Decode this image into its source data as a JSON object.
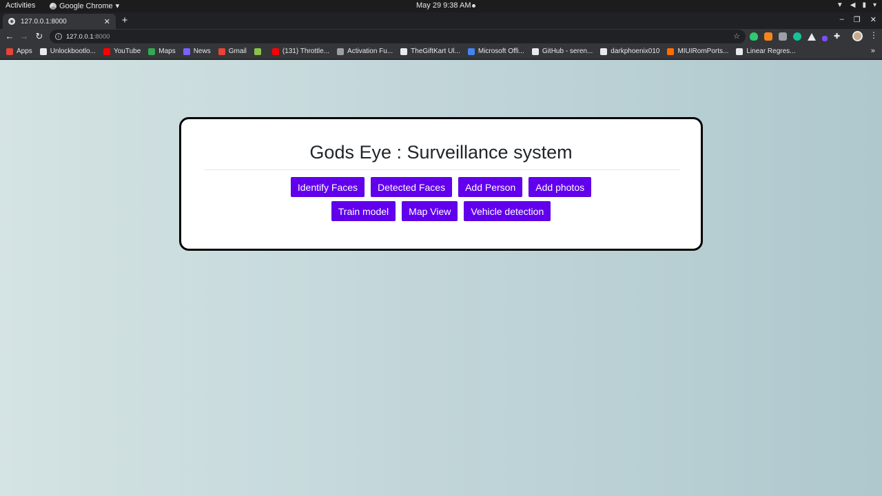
{
  "os": {
    "activities": "Activities",
    "app_name": "Google Chrome",
    "clock": "May 29   9:38 AM"
  },
  "browser": {
    "tab_title": "127.0.0.1:8000",
    "url_host": "127.0.0.1",
    "url_port": ":8000",
    "bookmarks": [
      {
        "label": "Apps",
        "icon_color": "#ea4335"
      },
      {
        "label": "Unlockbootlo...",
        "icon_color": "#e8eaed"
      },
      {
        "label": "YouTube",
        "icon_color": "#ff0000"
      },
      {
        "label": "Maps",
        "icon_color": "#34a853"
      },
      {
        "label": "News",
        "icon_color": "#7b61ff"
      },
      {
        "label": "Gmail",
        "icon_color": "#ea4335"
      },
      {
        "label": "",
        "icon_color": "#8bc34a"
      },
      {
        "label": "(131) Throttle...",
        "icon_color": "#ff0000"
      },
      {
        "label": "Activation Fu...",
        "icon_color": "#9aa0a6"
      },
      {
        "label": "TheGiftKart Ul...",
        "icon_color": "#e8eaed"
      },
      {
        "label": "Microsoft Offi...",
        "icon_color": "#4285f4"
      },
      {
        "label": "GitHub - seren...",
        "icon_color": "#e8eaed"
      },
      {
        "label": "darkphoenix010",
        "icon_color": "#e8eaed"
      },
      {
        "label": "MIUIRomPorts...",
        "icon_color": "#ff6d00"
      },
      {
        "label": "Linear Regres...",
        "icon_color": "#e8eaed"
      }
    ]
  },
  "page": {
    "title": "Gods Eye : Surveillance system",
    "button_color": "#6200ee",
    "buttons_row1": [
      "Identify Faces",
      "Detected Faces",
      "Add Person",
      "Add photos"
    ],
    "buttons_row2": [
      "Train model",
      "Map View",
      "Vehicle detection"
    ]
  }
}
